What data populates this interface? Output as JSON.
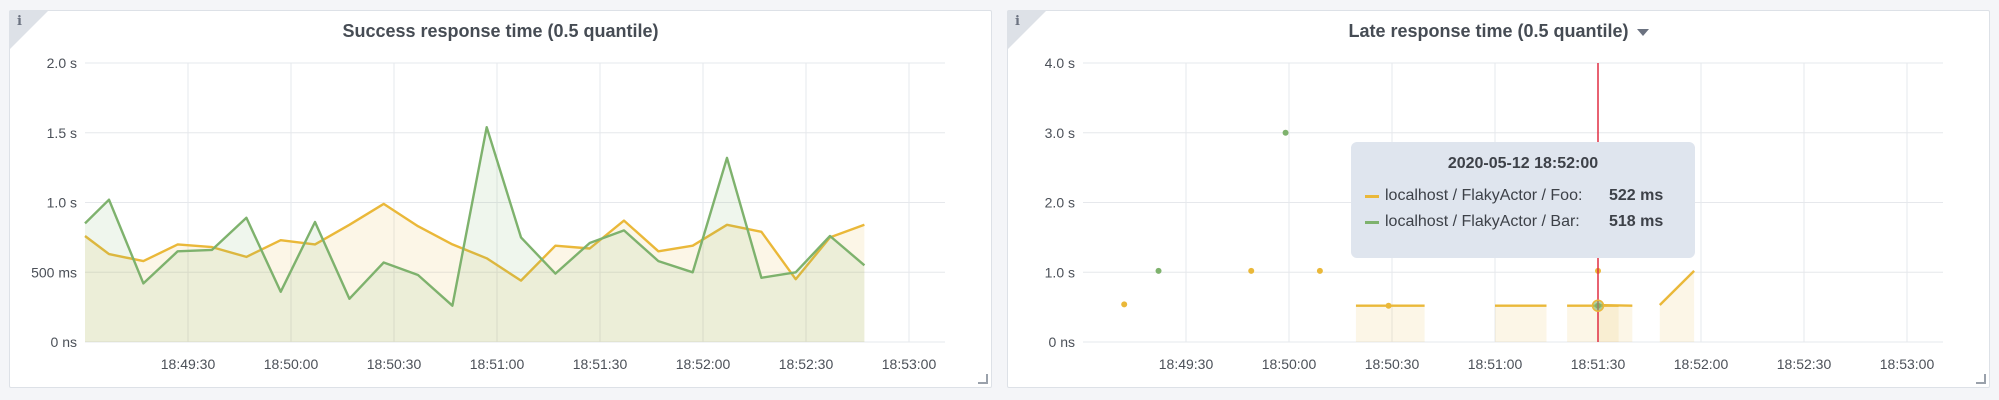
{
  "colors": {
    "foo": "#eab839",
    "bar": "#7eb26d",
    "marker": "#e02f44",
    "grid": "#e6e8ec"
  },
  "panels": [
    {
      "title": "Success response time (0.5 quantile)",
      "info_icon": "info-icon"
    },
    {
      "title": "Late response time (0.5 quantile)",
      "info_icon": "info-icon",
      "menu_icon": "chevron-down-icon"
    }
  ],
  "tooltip": {
    "time": "2020-05-12 18:52:00",
    "rows": [
      {
        "label": "localhost / FlakyActor / Foo:",
        "value": "522 ms"
      },
      {
        "label": "localhost / FlakyActor / Bar:",
        "value": "518 ms"
      }
    ]
  },
  "chart_data": [
    {
      "type": "area",
      "title": "Success response time (0.5 quantile)",
      "x_unit": "seconds after 18:49:00",
      "x_ticks": [
        "18:49:30",
        "18:50:00",
        "18:50:30",
        "18:51:00",
        "18:51:30",
        "18:52:00",
        "18:52:30",
        "18:53:00"
      ],
      "y_ticks": [
        "0 ns",
        "500 ms",
        "1.0 s",
        "1.5 s",
        "2.0 s"
      ],
      "ylim": [
        0,
        2.0
      ],
      "series": [
        {
          "name": "localhost / FlakyActor / Foo",
          "x": [
            0,
            7,
            17,
            27,
            37,
            47,
            57,
            67,
            77,
            87,
            97,
            107,
            117,
            127,
            137,
            147,
            157,
            167,
            177,
            187,
            197,
            207,
            217,
            227
          ],
          "y": [
            0.76,
            0.63,
            0.58,
            0.7,
            0.68,
            0.61,
            0.73,
            0.7,
            0.84,
            0.99,
            0.83,
            0.7,
            0.6,
            0.44,
            0.69,
            0.67,
            0.87,
            0.65,
            0.69,
            0.84,
            0.79,
            0.45,
            0.75,
            0.84
          ]
        },
        {
          "name": "localhost / FlakyActor / Bar",
          "x": [
            0,
            7,
            17,
            27,
            37,
            47,
            57,
            67,
            77,
            87,
            97,
            107,
            117,
            127,
            137,
            147,
            157,
            167,
            177,
            187,
            197,
            207,
            217,
            227
          ],
          "y": [
            0.85,
            1.02,
            0.42,
            0.65,
            0.66,
            0.89,
            0.36,
            0.86,
            0.31,
            0.57,
            0.48,
            0.26,
            1.54,
            0.75,
            0.49,
            0.71,
            0.8,
            0.58,
            0.5,
            1.32,
            0.46,
            0.5,
            0.76,
            0.55
          ]
        }
      ]
    },
    {
      "type": "scatter",
      "title": "Late response time (0.5 quantile)",
      "x_unit": "seconds after 18:49:00",
      "x_ticks": [
        "18:49:30",
        "18:50:00",
        "18:50:30",
        "18:51:00",
        "18:51:30",
        "18:52:00",
        "18:52:30",
        "18:53:00"
      ],
      "y_ticks": [
        "0 ns",
        "1.0 s",
        "2.0 s",
        "3.0 s",
        "4.0 s"
      ],
      "ylim": [
        0,
        4.0
      ],
      "series": [
        {
          "name": "localhost / FlakyActor / Foo",
          "points": [
            [
              12,
              0.54
            ],
            [
              49,
              1.02
            ],
            [
              69,
              1.02
            ],
            [
              89,
              0.52
            ],
            [
              150,
              1.02
            ]
          ],
          "segments": [
            [
              [
                79.5,
                0.52
              ],
              [
                99.5,
                0.52
              ]
            ],
            [
              [
                120,
                0.52
              ],
              [
                135,
                0.52
              ]
            ],
            [
              [
                141,
                0.52
              ],
              [
                156,
                0.52
              ]
            ],
            [
              [
                150,
                0.53
              ],
              [
                160,
                0.52
              ]
            ],
            [
              [
                168,
                0.53
              ],
              [
                178,
                1.02
              ]
            ]
          ]
        },
        {
          "name": "localhost / FlakyActor / Bar",
          "points": [
            [
              22,
              1.02
            ],
            [
              59,
              3.0
            ],
            [
              150,
              0.52
            ]
          ],
          "segments": []
        }
      ],
      "hover_x": 150
    }
  ]
}
